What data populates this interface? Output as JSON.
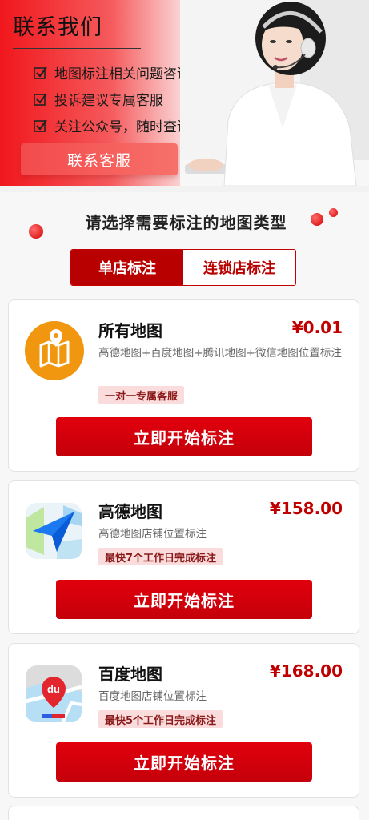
{
  "banner": {
    "title": "联系我们",
    "features": [
      "地图标注相关问题咨询",
      "投诉建议专属客服",
      "关注公众号，随时查询标注进度"
    ],
    "contact_button": "联系客服"
  },
  "section": {
    "title": "请选择需要标注的地图类型",
    "tabs": [
      {
        "label": "单店标注",
        "active": true
      },
      {
        "label": "连锁店标注",
        "active": false
      }
    ]
  },
  "cards": [
    {
      "name": "所有地图",
      "price": "¥0.01",
      "desc": "高德地图+百度地图+腾讯地图+微信地图位置标注",
      "badge": "一对一专属客服",
      "button": "立即开始标注",
      "icon": "map-pin-icon"
    },
    {
      "name": "高德地图",
      "price": "¥158.00",
      "desc": "高德地图店铺位置标注",
      "badge": "最快7个工作日完成标注",
      "button": "立即开始标注",
      "icon": "amap-logo-icon"
    },
    {
      "name": "百度地图",
      "price": "¥168.00",
      "desc": "百度地图店铺位置标注",
      "badge": "最快5个工作日完成标注",
      "button": "立即开始标注",
      "icon": "baidu-map-logo-icon"
    }
  ],
  "colors": {
    "accent": "#c40000",
    "brand_red": "#e1000d",
    "badge_bg": "#fbdcdc",
    "icon_orange": "#f0960f"
  },
  "logos": {
    "baidu_du": "du"
  }
}
